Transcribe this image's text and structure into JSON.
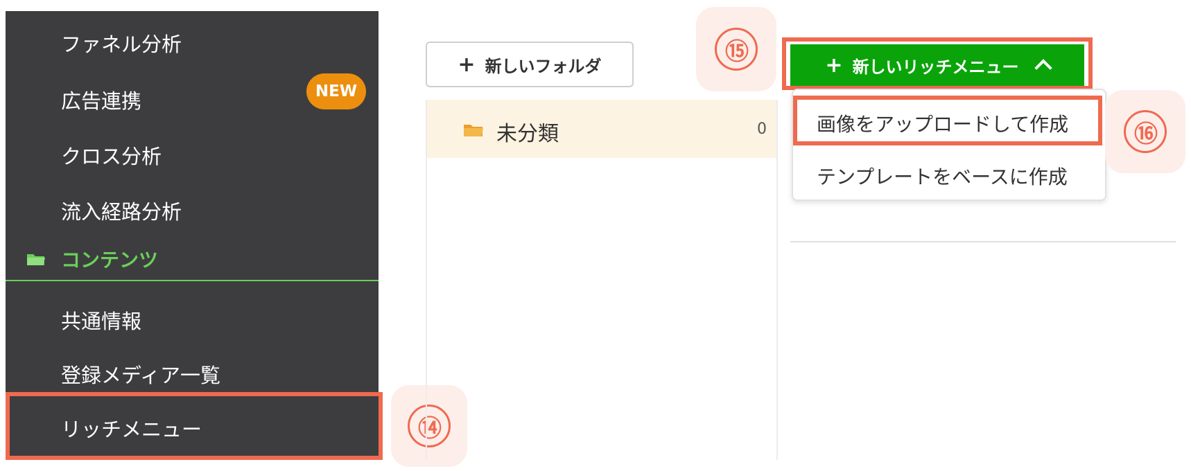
{
  "sidebar": {
    "items_top": [
      {
        "label": "ファネル分析"
      },
      {
        "label": "広告連携",
        "badge": "NEW"
      },
      {
        "label": "クロス分析"
      },
      {
        "label": "流入経路分析"
      }
    ],
    "section": {
      "label": "コンテンツ",
      "icon": "folder-icon"
    },
    "items_bottom": [
      {
        "label": "共通情報"
      },
      {
        "label": "登録メディア一覧"
      },
      {
        "label": "リッチメニュー"
      }
    ]
  },
  "toolbar": {
    "new_folder_label": "新しいフォルダ",
    "new_rich_menu_label": "新しいリッチメニュー"
  },
  "folders": [
    {
      "name": "未分類",
      "count": "0"
    }
  ],
  "dropdown": {
    "items": [
      {
        "label": "画像をアップロードして作成"
      },
      {
        "label": "テンプレートをベースに作成"
      }
    ]
  },
  "annotations": {
    "step14": "⑭",
    "step15": "⑮",
    "step16": "⑯"
  },
  "colors": {
    "sidebar_bg": "#3d3d40",
    "accent_green": "#6ccf5a",
    "button_green": "#0aa40a",
    "highlight": "#ef6a4f",
    "badge_orange": "#ec8f0e",
    "folder_row_bg": "#fdf3e2"
  }
}
